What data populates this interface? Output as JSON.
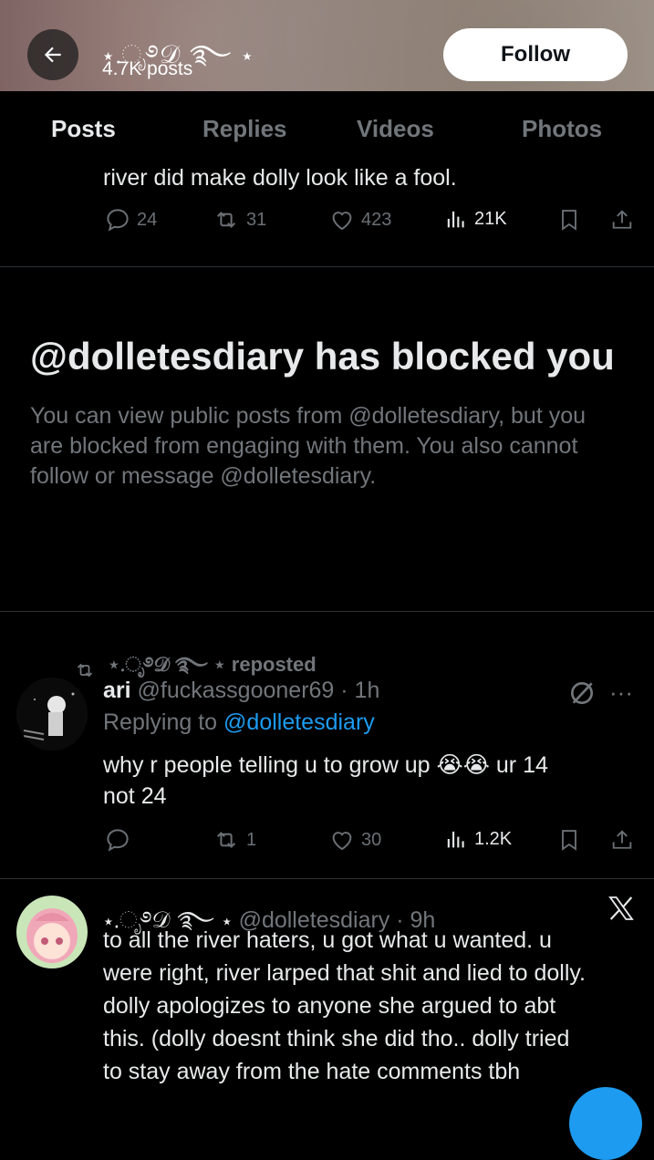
{
  "header": {
    "display_name": "⋆.ೃ࿔𝒟 ࿐ ⋆",
    "posts_count": "4.7K posts",
    "follow_label": "Follow"
  },
  "tabs": [
    {
      "label": "Posts"
    },
    {
      "label": "Replies"
    },
    {
      "label": "Videos"
    },
    {
      "label": "Photos"
    }
  ],
  "tweet1": {
    "text_tail": "river did make dolly look like a fool.",
    "replies": "24",
    "reposts": "31",
    "likes": "423",
    "views": "21K"
  },
  "blocked": {
    "title": "@dolletesdiary has blocked you",
    "body": "You can view public posts from @dolletesdiary, but you are blocked from engaging with them. You also cannot follow or message @dolletesdiary."
  },
  "tweet2": {
    "repost_label": "⋆.ೃ࿔𝒟 ࿐ ⋆ reposted",
    "name": "ari",
    "handle_time": "@fuckassgooner69 · 1h",
    "replying_prefix": "Replying to",
    "replying_handle": "@dolletesdiary",
    "text_line1": "why r people telling u to grow up",
    "emoji": "😭",
    "text_line1_tail": "ur 14",
    "text_line2": "not 24",
    "reposts": "1",
    "likes": "30",
    "views": "1.2K"
  },
  "tweet3": {
    "name": "⋆.ೃ࿔𝒟 ࿐ ⋆",
    "handle_time": "@dolletesdiary · 9h",
    "lines": [
      "to all the river haters, u got what u wanted. u",
      "were right, river larped that shit and lied to dolly.",
      "dolly apologizes to anyone she argued to abt",
      "this. (dolly doesnt think she did tho.. dolly tried",
      "to stay away from the hate comments tbh"
    ]
  },
  "colors": {
    "accent": "#1d9bf0",
    "muted": "#71767b",
    "background": "#000000"
  }
}
